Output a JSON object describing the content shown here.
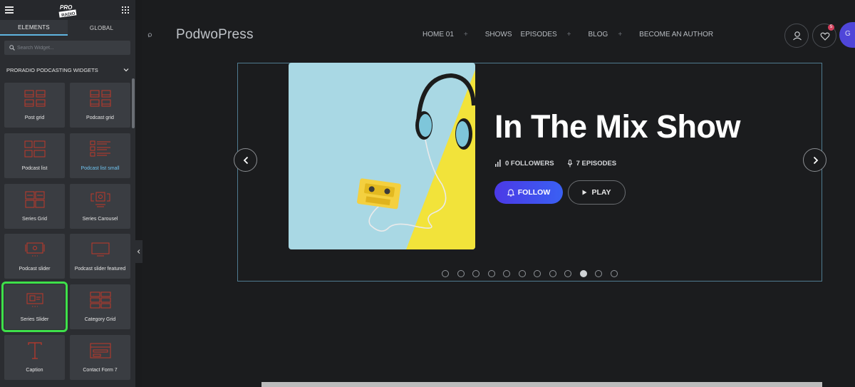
{
  "panel": {
    "tabs": [
      "ELEMENTS",
      "GLOBAL"
    ],
    "search_placeholder": "Search Widget...",
    "category": "PRORADIO PODCASTING WIDGETS",
    "widgets": [
      {
        "label": "Post grid",
        "icon": "post-grid-icon"
      },
      {
        "label": "Podcast grid",
        "icon": "podcast-grid-icon"
      },
      {
        "label": "Podcast list",
        "icon": "podcast-list-icon"
      },
      {
        "label": "Podcast list small",
        "icon": "podcast-list-small-icon"
      },
      {
        "label": "Series Grid",
        "icon": "series-grid-icon"
      },
      {
        "label": "Series Carousel",
        "icon": "series-carousel-icon"
      },
      {
        "label": "Podcast slider",
        "icon": "podcast-slider-icon"
      },
      {
        "label": "Podcast slider featured",
        "icon": "podcast-slider-featured-icon"
      },
      {
        "label": "Series Slider",
        "icon": "series-slider-icon"
      },
      {
        "label": "Category Grid",
        "icon": "category-grid-icon"
      },
      {
        "label": "Caption",
        "icon": "caption-icon"
      },
      {
        "label": "Contact Form 7",
        "icon": "contact-form-icon"
      }
    ],
    "highlighted_widget": "Series Slider",
    "logo_text_top": "PRO",
    "logo_text_bottom": "RADIO"
  },
  "site": {
    "brand": "PodwoPress",
    "nav": [
      {
        "label": "HOME 01",
        "dropdown": true
      },
      {
        "label": "SHOWS",
        "dropdown": false
      },
      {
        "label": "EPISODES",
        "dropdown": true
      },
      {
        "label": "BLOG",
        "dropdown": true
      },
      {
        "label": "BECOME AN AUTHOR",
        "dropdown": false
      }
    ],
    "nav_plus": "+",
    "wishlist_count": "5",
    "cut_button_letter": "G"
  },
  "slider": {
    "title": "In The Mix Show",
    "followers": "0 FOLLOWERS",
    "episodes": "7 EPISODES",
    "follow_label": "FOLLOW",
    "play_label": "PLAY",
    "dot_count": 12,
    "active_dot": 10
  },
  "colors": {
    "accent_blue": "#5fb4e0",
    "highlight_green": "#3ee04a",
    "widget_icon_red": "#c0392b",
    "follow_gradient_start": "#4b39e6",
    "follow_gradient_end": "#3a60f3"
  }
}
